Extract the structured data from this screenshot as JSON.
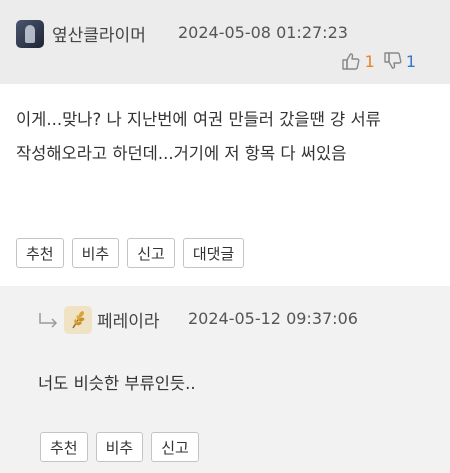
{
  "comment": {
    "author": "옆산클라이머",
    "timestamp": "2024-05-08 01:27:23",
    "likes": "1",
    "dislikes": "1",
    "body": "이게...맞나? 나 지난번에 여권 만들러 갔을땐 걍 서류 작성해오라고 하던데...거기에 저 항목 다 써있음",
    "actions": {
      "recommend": "추천",
      "not_recommend": "비추",
      "report": "신고",
      "reply": "대댓글"
    }
  },
  "reply": {
    "author": "페레이라",
    "timestamp": "2024-05-12 09:37:06",
    "body": "너도 비슷한 부류인듯..",
    "actions": {
      "recommend": "추천",
      "not_recommend": "비추",
      "report": "신고"
    }
  },
  "icons": {
    "thumbs_up": "thumbs-up-icon",
    "thumbs_down": "thumbs-down-icon",
    "reply_arrow": "reply-arrow-icon",
    "reply_avatar": "wheat-icon"
  },
  "colors": {
    "like_count": "#e8842a",
    "dislike_count": "#3579c6",
    "header_bg": "#ececec",
    "reply_bg": "#f2f2f2"
  }
}
